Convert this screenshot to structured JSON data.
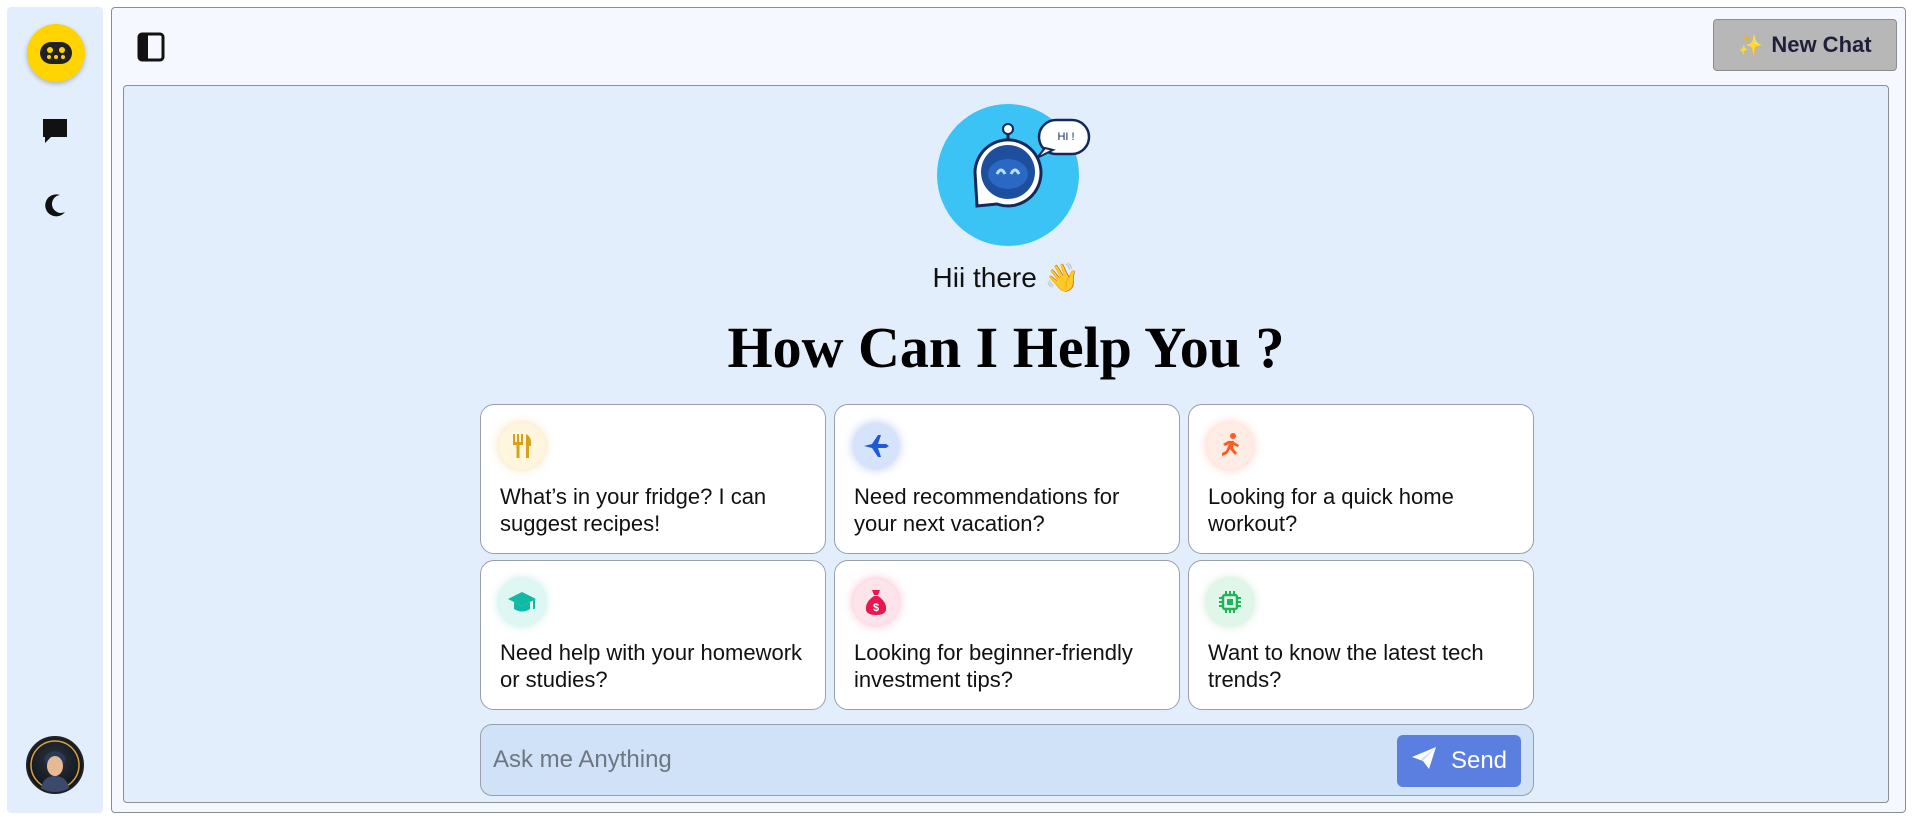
{
  "app": {
    "accent_color": "#ffd400",
    "panel_color": "#e3eefc"
  },
  "sidebar": {
    "items": [
      {
        "name": "bot-logo",
        "icon": "robot-face-icon"
      },
      {
        "name": "chats",
        "icon": "chat-bubble-icon"
      },
      {
        "name": "theme",
        "icon": "moon-icon"
      }
    ],
    "avatar": "user-avatar"
  },
  "header": {
    "toggle_icon": "sidebar-toggle-icon",
    "new_chat_icon": "sparkles-icon",
    "new_chat_label": "New Chat"
  },
  "welcome": {
    "bot_bubble": "HI !",
    "greeting": "Hii there 👋",
    "headline": "How Can I Help You ?"
  },
  "suggestions": [
    {
      "icon": "fork-knife-icon",
      "color": "#f0b429",
      "text": "What’s in your fridge? I can suggest recipes!"
    },
    {
      "icon": "airplane-icon",
      "color": "#1e5ad8",
      "text": "Need recommendations for your next vacation?"
    },
    {
      "icon": "running-icon",
      "color": "#ff5a1f",
      "text": "Looking for a quick home workout?"
    },
    {
      "icon": "graduation-cap-icon",
      "color": "#10b8a6",
      "text": "Need help with your homework or studies?"
    },
    {
      "icon": "money-bag-icon",
      "color": "#e8174f",
      "text": "Looking for beginner-friendly investment tips?"
    },
    {
      "icon": "chip-icon",
      "color": "#1fb35a",
      "text": "Want to know the latest tech trends?"
    }
  ],
  "composer": {
    "placeholder": "Ask me Anything",
    "value": "",
    "send_label": "Send",
    "send_icon": "paper-plane-icon"
  }
}
